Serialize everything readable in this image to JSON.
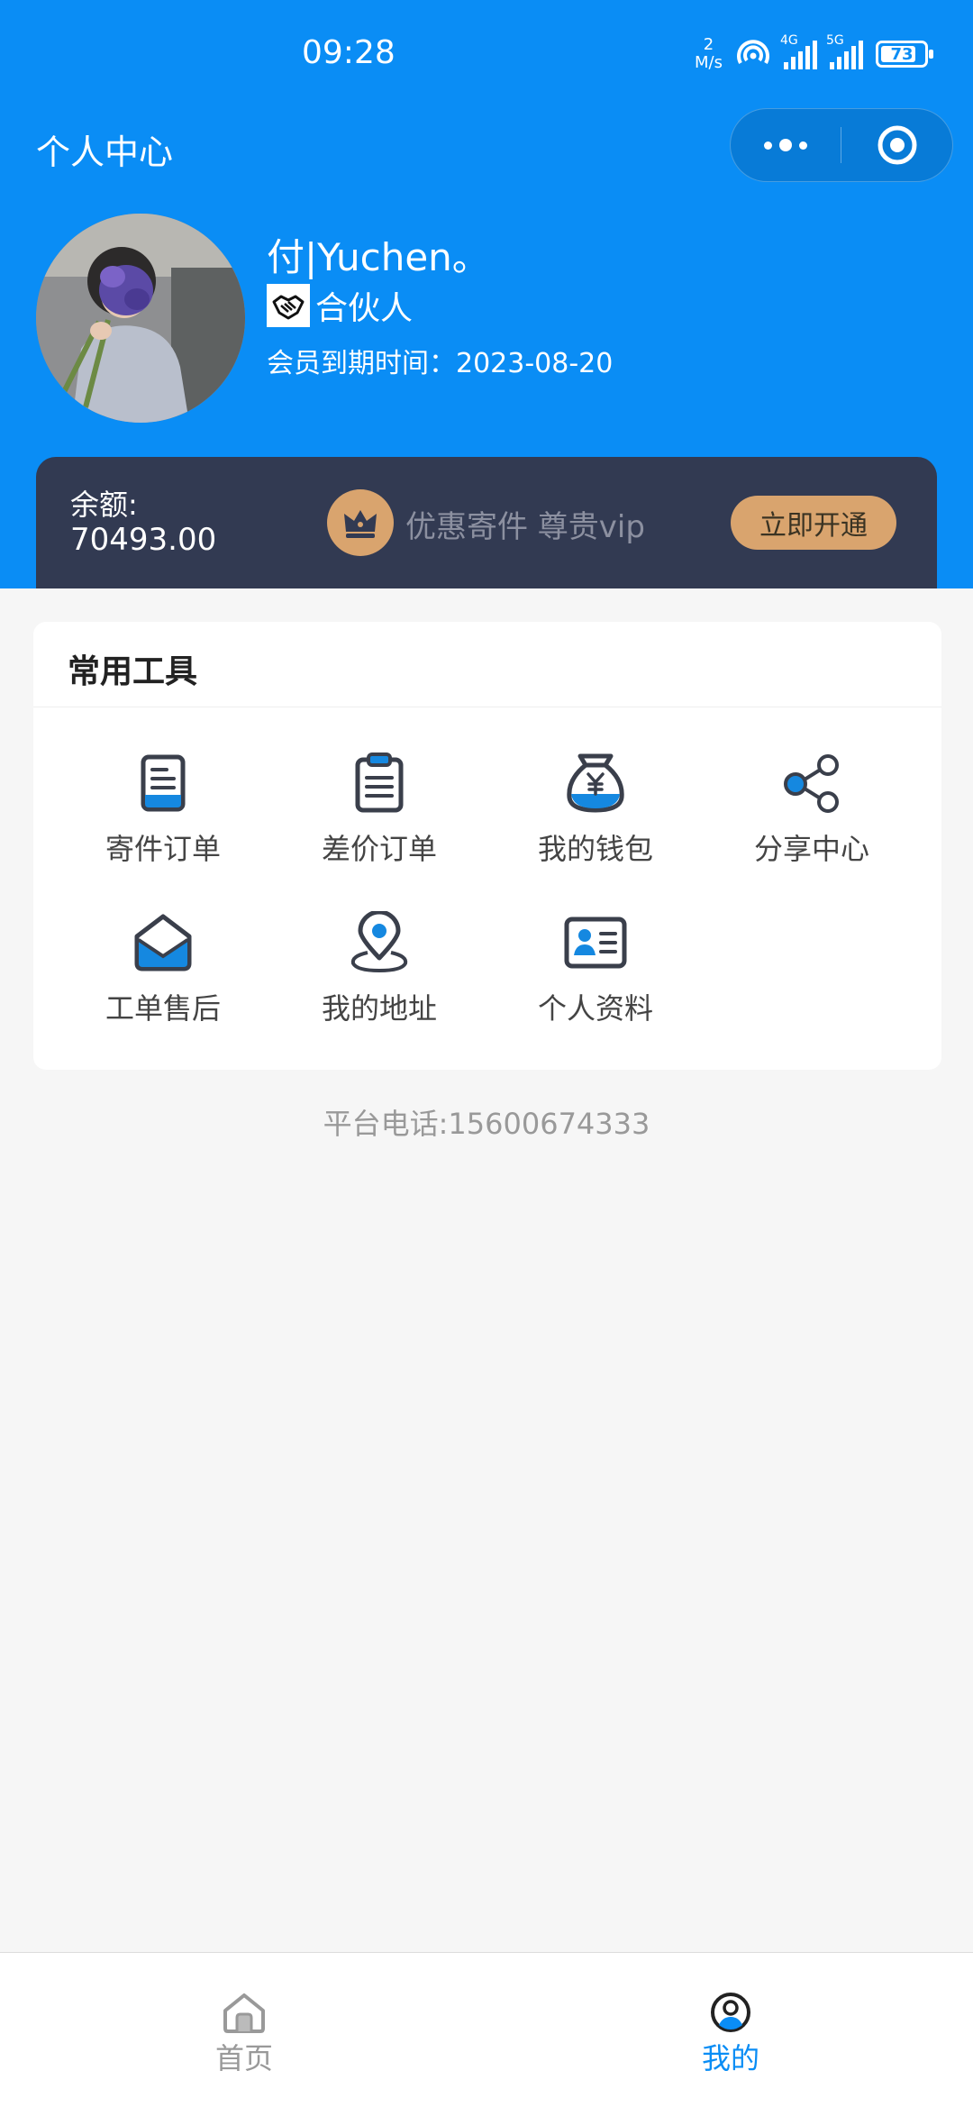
{
  "status_bar": {
    "time": "09:28",
    "net_speed_value": "2",
    "net_speed_unit": "M/s",
    "signal_1_tag": "4G",
    "signal_2_tag": "5G",
    "battery": "73"
  },
  "nav": {
    "title": "个人中心"
  },
  "profile": {
    "name": "付|Yuchen。",
    "role": "合伙人",
    "expire_text": "会员到期时间：2023-08-20"
  },
  "vip_card": {
    "balance_label": "余额:",
    "balance_value": "70493.00",
    "promo": "优惠寄件 尊贵vip",
    "open_button": "立即开通"
  },
  "tools": {
    "title": "常用工具",
    "items": [
      {
        "label": "寄件订单",
        "icon": "document-icon"
      },
      {
        "label": "差价订单",
        "icon": "clipboard-icon"
      },
      {
        "label": "我的钱包",
        "icon": "money-bag-icon"
      },
      {
        "label": "分享中心",
        "icon": "share-icon"
      },
      {
        "label": "工单售后",
        "icon": "envelope-icon"
      },
      {
        "label": "我的地址",
        "icon": "location-pin-icon"
      },
      {
        "label": "个人资料",
        "icon": "id-card-icon"
      }
    ]
  },
  "platform_phone": "平台电话:15600674333",
  "tabbar": {
    "home": "首页",
    "mine": "我的"
  },
  "colors": {
    "primary": "#0a8df5",
    "vip_card_bg": "#323a52",
    "gold": "#d9a46e",
    "icon_stroke": "#3a3f4b",
    "icon_fill": "#1588e0"
  }
}
